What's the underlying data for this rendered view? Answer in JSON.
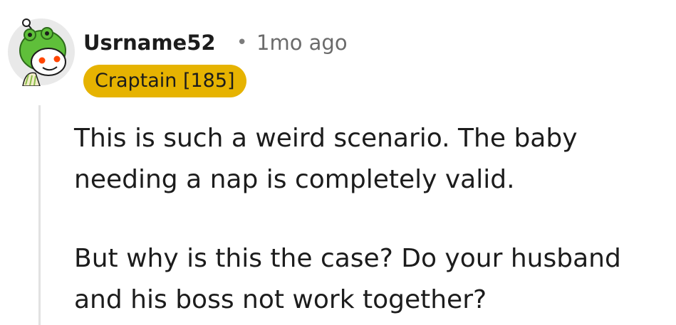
{
  "comment": {
    "username": "Usrname52",
    "separator": "•",
    "timestamp": "1mo ago",
    "flair": "Craptain [185]",
    "paragraphs": [
      "This is such a weird scenario. The baby needing a nap is completely valid.",
      "But why is this the case? Do your husband and his boss not work together?"
    ]
  },
  "avatar": {
    "icon": "snoo-frog-hat-avatar",
    "hat_color": "#5fbf3a",
    "background_color": "#e9e9e9"
  },
  "colors": {
    "flair_background": "#e6b301",
    "username_text": "#1c1c1c",
    "timestamp_text": "#6b6b6b",
    "thread_line": "#e2e2e2"
  }
}
